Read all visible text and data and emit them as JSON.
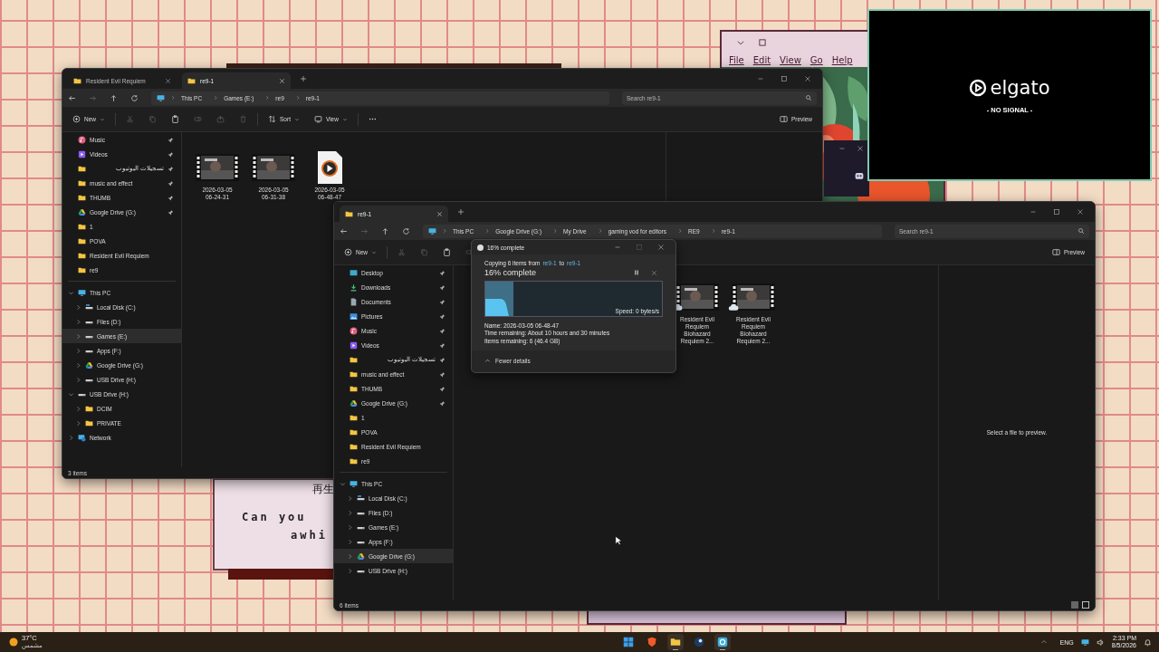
{
  "desktop": {
    "retro_window": {
      "menu": [
        "File",
        "Edit",
        "View",
        "Go",
        "Help"
      ]
    },
    "retro_card": {
      "lines": [
        "再生",
        "Can you",
        "awhi"
      ]
    }
  },
  "explorers": [
    {
      "tabs": [
        {
          "label": "Resident Evil Requiem",
          "selected": false
        },
        {
          "label": "re9-1",
          "selected": true
        }
      ],
      "breadcrumb": [
        "This PC",
        "Games (E:)",
        "re9",
        "re9-1"
      ],
      "search": {
        "placeholder": "Search re9-1"
      },
      "toolbar": [
        {
          "kind": "new",
          "label": "New",
          "disabled": false
        },
        {
          "kind": "cut",
          "disabled": true
        },
        {
          "kind": "copy",
          "disabled": true
        },
        {
          "kind": "paste",
          "disabled": false
        },
        {
          "kind": "rename",
          "disabled": true
        },
        {
          "kind": "share",
          "disabled": true
        },
        {
          "kind": "delete",
          "disabled": true
        },
        {
          "kind": "sort",
          "label": "Sort",
          "disabled": false
        },
        {
          "kind": "view",
          "label": "View",
          "disabled": false
        },
        {
          "kind": "more",
          "disabled": false
        }
      ],
      "preview_button": "Preview",
      "quick_access": [
        {
          "kind": "music",
          "label": "Music",
          "pinned": true,
          "selected": false
        },
        {
          "kind": "videos",
          "label": "Videos",
          "pinned": true,
          "selected": false
        },
        {
          "kind": "folder",
          "label": "تسجيلات اليوتيوب",
          "pinned": true,
          "selected": false
        },
        {
          "kind": "folder",
          "label": "music and effect",
          "pinned": true,
          "selected": false
        },
        {
          "kind": "folder",
          "label": "THUMB",
          "pinned": true,
          "selected": false
        },
        {
          "kind": "gdrive",
          "label": "Google Drive (G:)",
          "pinned": true,
          "selected": false
        },
        {
          "kind": "folder",
          "label": "1",
          "pinned": false,
          "selected": false
        },
        {
          "kind": "folder",
          "label": "POVA",
          "pinned": false,
          "selected": false
        },
        {
          "kind": "folder",
          "label": "Resident Evil Requiem",
          "pinned": false,
          "selected": false
        },
        {
          "kind": "folder",
          "label": "re9",
          "pinned": false,
          "selected": false
        }
      ],
      "tree": [
        {
          "kind": "pc",
          "label": "This PC",
          "expanded": true,
          "selected": false,
          "children": [
            {
              "kind": "windisk",
              "label": "Local Disk (C:)",
              "expanded": false,
              "selected": false
            },
            {
              "kind": "disk",
              "label": "Files (D:)",
              "expanded": false,
              "selected": false
            },
            {
              "kind": "disk",
              "label": "Games (E:)",
              "expanded": false,
              "selected": true
            },
            {
              "kind": "disk",
              "label": "Apps (F:)",
              "expanded": false,
              "selected": false
            },
            {
              "kind": "gdrive",
              "label": "Google Drive (G:)",
              "expanded": false,
              "selected": false
            },
            {
              "kind": "disk",
              "label": "USB Drive (H:)",
              "expanded": false,
              "selected": false
            }
          ]
        },
        {
          "kind": "disk",
          "label": "USB Drive (H:)",
          "expanded": true,
          "selected": false,
          "children": [
            {
              "kind": "folder",
              "label": "DCIM",
              "expanded": false,
              "selected": false
            },
            {
              "kind": "folder",
              "label": "PRIVATE",
              "expanded": false,
              "selected": false
            }
          ]
        },
        {
          "kind": "network",
          "label": "Network",
          "expanded": false,
          "selected": false
        }
      ],
      "files": [
        {
          "kind": "video",
          "name": "2026-03-05 06-24-31",
          "cloud": false
        },
        {
          "kind": "video",
          "name": "2026-03-05 06-31-38",
          "cloud": false
        },
        {
          "kind": "media",
          "name": "2026-03-05 06-48-47",
          "cloud": false
        }
      ],
      "status": "3 items"
    },
    {
      "tabs": [
        {
          "label": "re9-1",
          "selected": true
        }
      ],
      "breadcrumb": [
        "This PC",
        "Google Drive (G:)",
        "My Drive",
        "gaming vod for editors",
        "RE9",
        "re9-1"
      ],
      "search": {
        "placeholder": "Search re9-1"
      },
      "toolbar": [
        {
          "kind": "new",
          "label": "New",
          "disabled": false
        },
        {
          "kind": "cut",
          "disabled": true
        },
        {
          "kind": "copy",
          "disabled": true
        },
        {
          "kind": "paste",
          "disabled": false
        },
        {
          "kind": "rename",
          "disabled": true
        }
      ],
      "preview_button": "Preview",
      "quick_access": [
        {
          "kind": "desktop",
          "label": "Desktop",
          "pinned": true,
          "selected": false
        },
        {
          "kind": "downloads",
          "label": "Downloads",
          "pinned": true,
          "selected": false
        },
        {
          "kind": "documents",
          "label": "Documents",
          "pinned": true,
          "selected": false
        },
        {
          "kind": "pictures",
          "label": "Pictures",
          "pinned": true,
          "selected": false
        },
        {
          "kind": "music",
          "label": "Music",
          "pinned": true,
          "selected": false
        },
        {
          "kind": "videos",
          "label": "Videos",
          "pinned": true,
          "selected": false
        },
        {
          "kind": "folder",
          "label": "تسجيلات اليوتيوب",
          "pinned": true,
          "selected": false
        },
        {
          "kind": "folder",
          "label": "music and effect",
          "pinned": true,
          "selected": false
        },
        {
          "kind": "folder",
          "label": "THUMB",
          "pinned": true,
          "selected": false
        },
        {
          "kind": "gdrive",
          "label": "Google Drive (G:)",
          "pinned": true,
          "selected": false
        },
        {
          "kind": "folder",
          "label": "1",
          "pinned": false,
          "selected": false
        },
        {
          "kind": "folder",
          "label": "POVA",
          "pinned": false,
          "selected": false
        },
        {
          "kind": "folder",
          "label": "Resident Evil Requiem",
          "pinned": false,
          "selected": false
        },
        {
          "kind": "folder",
          "label": "re9",
          "pinned": false,
          "selected": false
        }
      ],
      "tree": [
        {
          "kind": "pc",
          "label": "This PC",
          "expanded": true,
          "selected": false,
          "children": [
            {
              "kind": "windisk",
              "label": "Local Disk (C:)",
              "expanded": false,
              "selected": false
            },
            {
              "kind": "disk",
              "label": "Files (D:)",
              "expanded": false,
              "selected": false
            },
            {
              "kind": "disk",
              "label": "Games (E:)",
              "expanded": false,
              "selected": false
            },
            {
              "kind": "disk",
              "label": "Apps (F:)",
              "expanded": false,
              "selected": false
            },
            {
              "kind": "gdrive",
              "label": "Google Drive (G:)",
              "expanded": false,
              "selected": true
            },
            {
              "kind": "disk",
              "label": "USB Drive (H:)",
              "expanded": false,
              "selected": false
            }
          ]
        }
      ],
      "files": [
        {
          "kind": "video",
          "name": "Resident Evil Requiem Biohazard Requiem 2...",
          "cloud": true
        },
        {
          "kind": "video",
          "name": "Resident Evil Requiem Biohazard Requiem 2...",
          "cloud": true
        }
      ],
      "preview_message": "Select a file to preview.",
      "status": "6 items"
    }
  ],
  "copy_dialog": {
    "title": "16% complete",
    "prefix": "Copying 6 items from",
    "source": "re9-1",
    "joiner": "to",
    "destination": "re9-1",
    "heading": "16% complete",
    "level": 0.16,
    "speed": "Speed: 0 bytes/s",
    "details": [
      "Name: 2026-03-05 06-48-47",
      "Time remaining: About 10 hours and 30 minutes",
      "Items remaining: 6 (46.4 GB)"
    ],
    "toggle": "Fewer details"
  },
  "capture_window": {
    "logo": "elgato",
    "status": "- NO SIGNAL -"
  },
  "taskbar": {
    "weather": {
      "temperature": "37°C",
      "condition": "مشمس"
    },
    "apps": [
      {
        "kind": "start",
        "running": false
      },
      {
        "kind": "shield",
        "running": false
      },
      {
        "kind": "folder",
        "running": true
      },
      {
        "kind": "steam",
        "running": false
      },
      {
        "kind": "app",
        "running": true
      }
    ],
    "language": "ENG",
    "time": "2:33 PM",
    "date": "8/5/2026"
  }
}
